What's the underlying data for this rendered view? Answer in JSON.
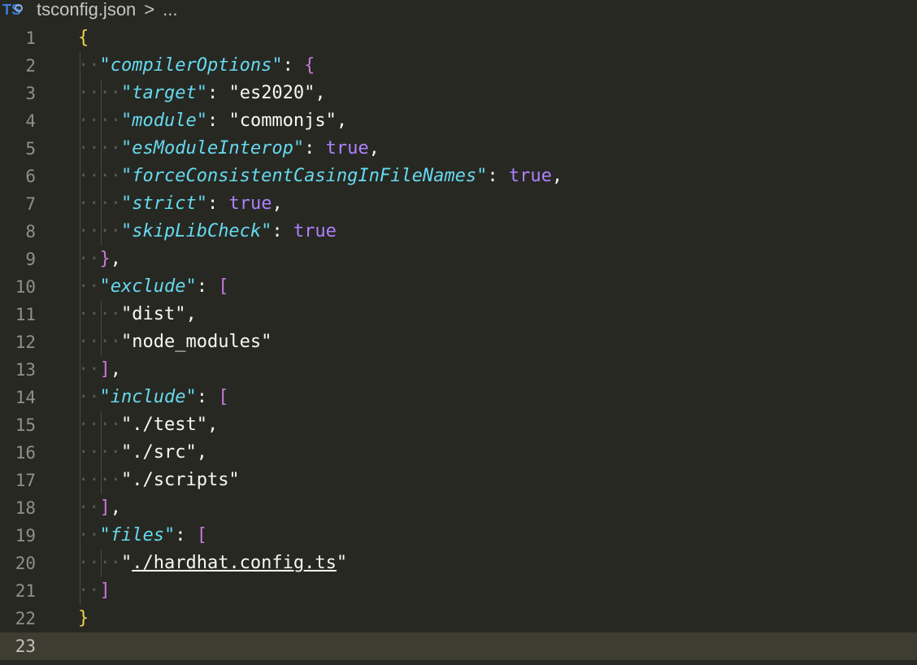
{
  "breadcrumb": {
    "icon_label": "TS",
    "file_name": "tsconfig.json",
    "separator": ">",
    "more": "..."
  },
  "editor": {
    "lines": [
      {
        "n": "1",
        "dots": "",
        "parts": [
          {
            "t": "{",
            "c": "brace-root"
          }
        ]
      },
      {
        "n": "2",
        "dots": "··",
        "parts": [
          {
            "t": "\"compilerOptions\"",
            "c": "key"
          },
          {
            "t": ": ",
            "c": "punc"
          },
          {
            "t": "{",
            "c": "brace-l2"
          }
        ]
      },
      {
        "n": "3",
        "dots": "····",
        "parts": [
          {
            "t": "\"target\"",
            "c": "key"
          },
          {
            "t": ": ",
            "c": "punc"
          },
          {
            "t": "\"es2020\"",
            "c": "plain-str"
          },
          {
            "t": ",",
            "c": "punc"
          }
        ]
      },
      {
        "n": "4",
        "dots": "····",
        "parts": [
          {
            "t": "\"module\"",
            "c": "key"
          },
          {
            "t": ": ",
            "c": "punc"
          },
          {
            "t": "\"commonjs\"",
            "c": "plain-str"
          },
          {
            "t": ",",
            "c": "punc"
          }
        ]
      },
      {
        "n": "5",
        "dots": "····",
        "parts": [
          {
            "t": "\"esModuleInterop\"",
            "c": "key"
          },
          {
            "t": ": ",
            "c": "punc"
          },
          {
            "t": "true",
            "c": "bool"
          },
          {
            "t": ",",
            "c": "punc"
          }
        ]
      },
      {
        "n": "6",
        "dots": "····",
        "parts": [
          {
            "t": "\"forceConsistentCasingInFileNames\"",
            "c": "key"
          },
          {
            "t": ": ",
            "c": "punc"
          },
          {
            "t": "true",
            "c": "bool"
          },
          {
            "t": ",",
            "c": "punc"
          }
        ]
      },
      {
        "n": "7",
        "dots": "····",
        "parts": [
          {
            "t": "\"strict\"",
            "c": "key"
          },
          {
            "t": ": ",
            "c": "punc"
          },
          {
            "t": "true",
            "c": "bool"
          },
          {
            "t": ",",
            "c": "punc"
          }
        ]
      },
      {
        "n": "8",
        "dots": "····",
        "parts": [
          {
            "t": "\"skipLibCheck\"",
            "c": "key"
          },
          {
            "t": ": ",
            "c": "punc"
          },
          {
            "t": "true",
            "c": "bool"
          }
        ]
      },
      {
        "n": "9",
        "dots": "··",
        "parts": [
          {
            "t": "}",
            "c": "brace-l2"
          },
          {
            "t": ",",
            "c": "punc"
          }
        ]
      },
      {
        "n": "10",
        "dots": "··",
        "parts": [
          {
            "t": "\"exclude\"",
            "c": "key"
          },
          {
            "t": ": ",
            "c": "punc"
          },
          {
            "t": "[",
            "c": "bracket"
          }
        ]
      },
      {
        "n": "11",
        "dots": "····",
        "parts": [
          {
            "t": "\"dist\"",
            "c": "plain-str"
          },
          {
            "t": ",",
            "c": "punc"
          }
        ]
      },
      {
        "n": "12",
        "dots": "····",
        "parts": [
          {
            "t": "\"node_modules\"",
            "c": "plain-str"
          }
        ]
      },
      {
        "n": "13",
        "dots": "··",
        "parts": [
          {
            "t": "]",
            "c": "bracket"
          },
          {
            "t": ",",
            "c": "punc"
          }
        ]
      },
      {
        "n": "14",
        "dots": "··",
        "parts": [
          {
            "t": "\"include\"",
            "c": "key"
          },
          {
            "t": ": ",
            "c": "punc"
          },
          {
            "t": "[",
            "c": "bracket"
          }
        ]
      },
      {
        "n": "15",
        "dots": "····",
        "parts": [
          {
            "t": "\"./test\"",
            "c": "plain-str"
          },
          {
            "t": ",",
            "c": "punc"
          }
        ]
      },
      {
        "n": "16",
        "dots": "····",
        "parts": [
          {
            "t": "\"./src\"",
            "c": "plain-str"
          },
          {
            "t": ",",
            "c": "punc"
          }
        ]
      },
      {
        "n": "17",
        "dots": "····",
        "parts": [
          {
            "t": "\"./scripts\"",
            "c": "plain-str"
          }
        ]
      },
      {
        "n": "18",
        "dots": "··",
        "parts": [
          {
            "t": "]",
            "c": "bracket"
          },
          {
            "t": ",",
            "c": "punc"
          }
        ]
      },
      {
        "n": "19",
        "dots": "··",
        "parts": [
          {
            "t": "\"files\"",
            "c": "key"
          },
          {
            "t": ": ",
            "c": "punc"
          },
          {
            "t": "[",
            "c": "bracket"
          }
        ]
      },
      {
        "n": "20",
        "dots": "····",
        "parts": [
          {
            "t": "\"",
            "c": "plain-str"
          },
          {
            "t": "./hardhat.config.ts",
            "c": "plain-str link"
          },
          {
            "t": "\"",
            "c": "plain-str"
          }
        ]
      },
      {
        "n": "21",
        "dots": "··",
        "parts": [
          {
            "t": "]",
            "c": "bracket"
          }
        ]
      },
      {
        "n": "22",
        "dots": "",
        "parts": [
          {
            "t": "}",
            "c": "brace-root"
          }
        ]
      },
      {
        "n": "23",
        "dots": "",
        "parts": [],
        "current": true
      }
    ]
  },
  "colors": {
    "background": "#272822",
    "current_line": "#3e3d32",
    "key": "#66d9ef",
    "boolean": "#ae81ff",
    "root_brace": "#f0d34a",
    "nested_brace": "#c678dd"
  }
}
